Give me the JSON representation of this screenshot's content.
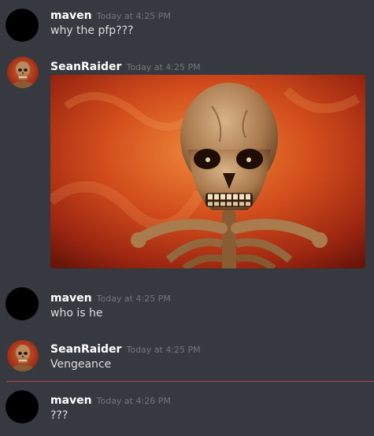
{
  "messages": [
    {
      "username": "maven",
      "timestamp": "Today at 4:25 PM",
      "content": "why the pfp???",
      "avatar": "blacked-out-avatar"
    },
    {
      "username": "SeanRaider",
      "timestamp": "Today at 4:25 PM",
      "content": "",
      "avatar": "skeleton-avatar",
      "attachment": "skeleton-image"
    },
    {
      "username": "maven",
      "timestamp": "Today at 4:25 PM",
      "content": "who is he",
      "avatar": "blacked-out-avatar"
    },
    {
      "username": "SeanRaider",
      "timestamp": "Today at 4:25 PM",
      "content": "Vengeance",
      "avatar": "skeleton-avatar"
    },
    {
      "username": "maven",
      "timestamp": "Today at 4:26 PM",
      "content": "???",
      "avatar": "blacked-out-avatar"
    }
  ],
  "colors": {
    "background": "#36393f",
    "username": "#ffffff",
    "timestamp": "#72767d",
    "text": "#dcddde",
    "new_message_divider": "#b8414a"
  }
}
